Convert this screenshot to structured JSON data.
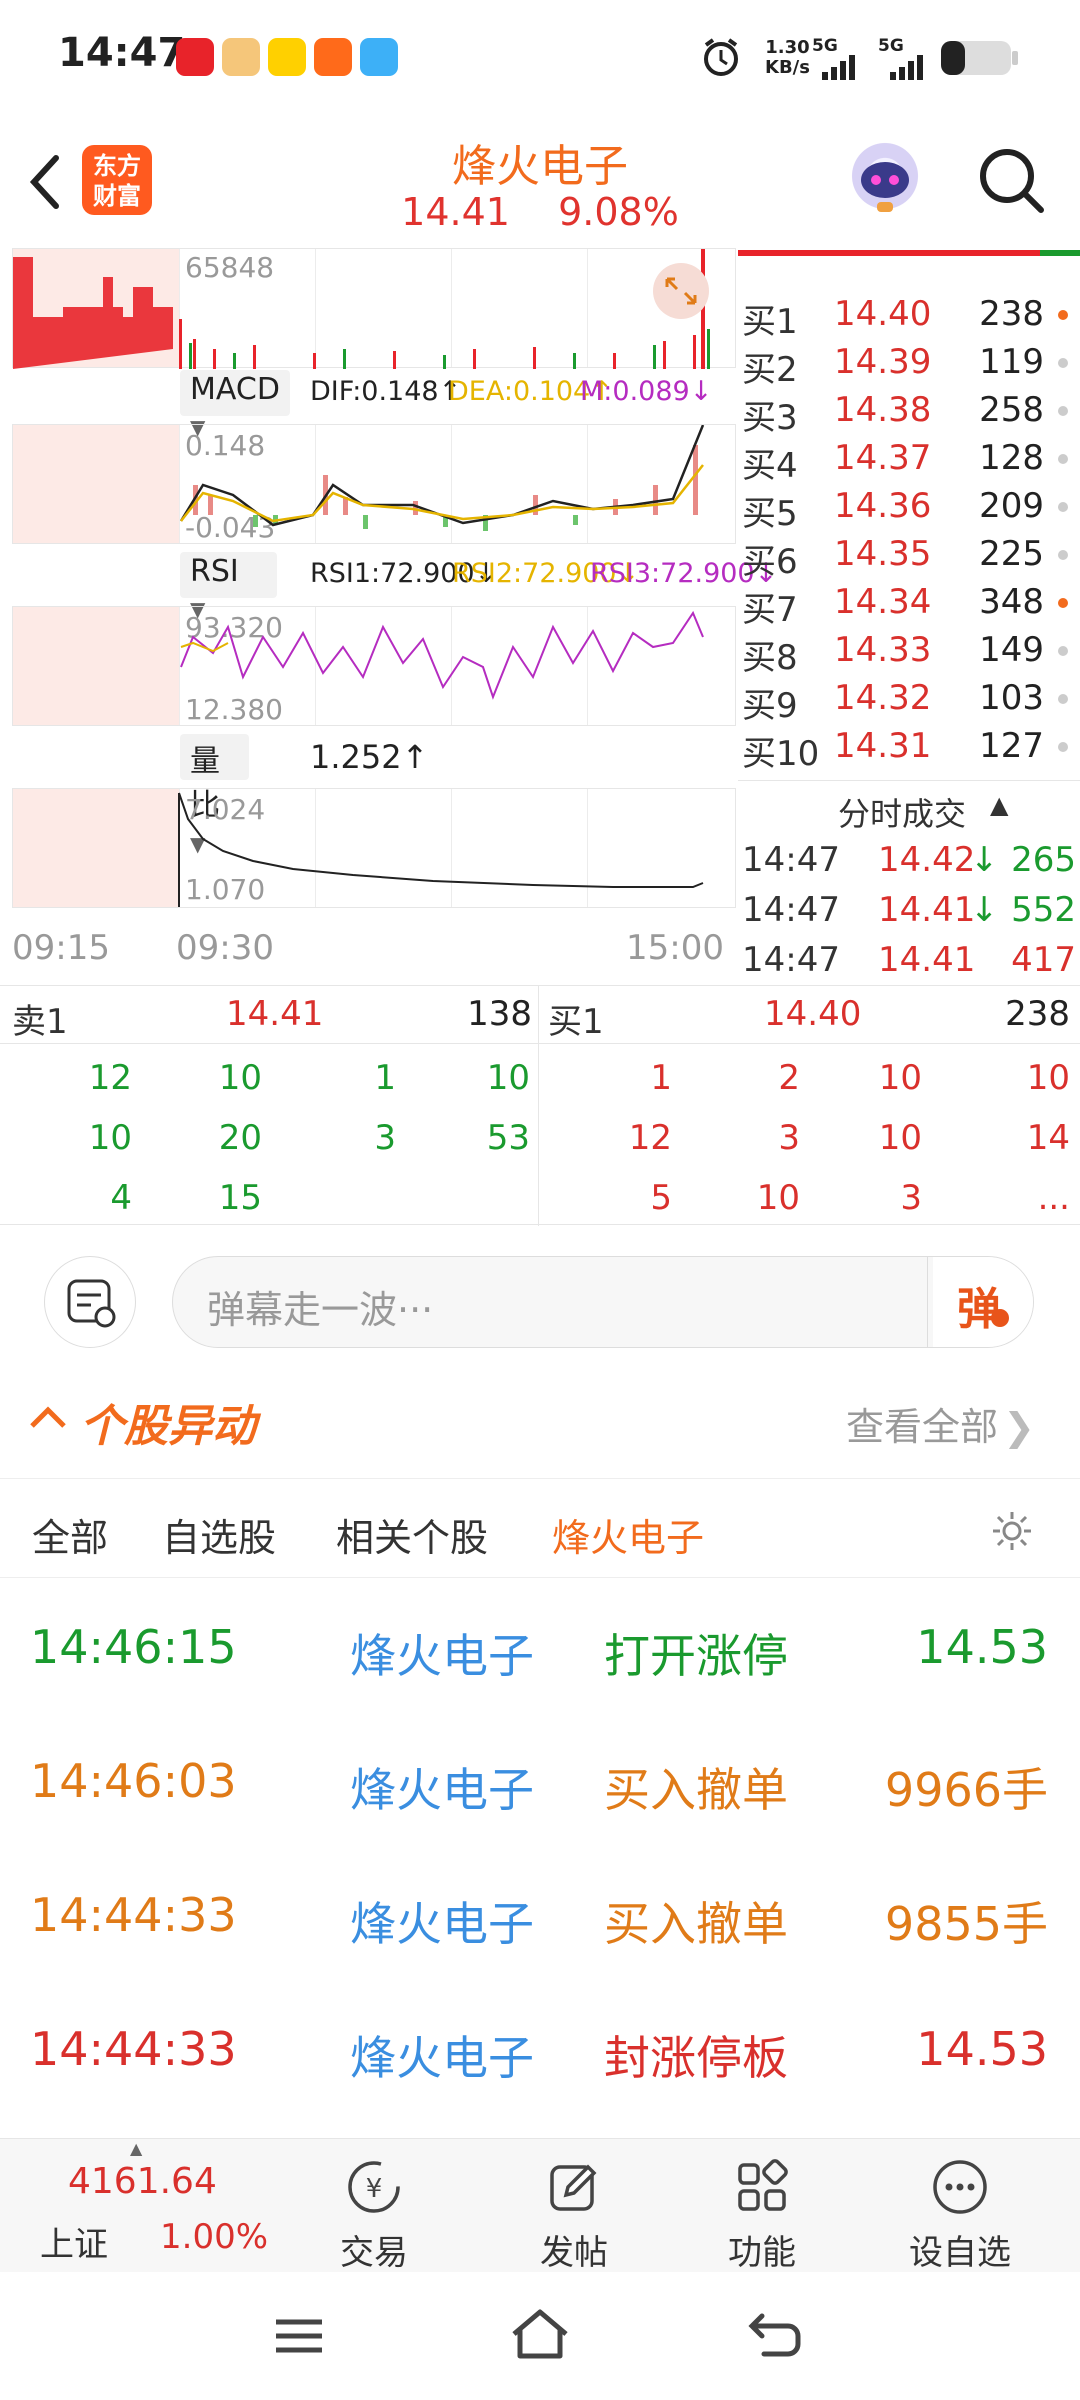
{
  "status_bar": {
    "time": "14:47",
    "net_speed_value": "1.30",
    "net_speed_unit": "KB/s",
    "sim1": "5G",
    "sim2": "5G",
    "app_icons": [
      "app-icon-1",
      "app-icon-2",
      "meituan-icon",
      "app-icon-4",
      "app-icon-5"
    ]
  },
  "header": {
    "logo_line1": "东方",
    "logo_line2": "财富",
    "stock_name": "烽火电子",
    "price": "14.41",
    "change_pct": "9.08%"
  },
  "chart": {
    "volume_label": "65848",
    "macd": {
      "selector": "MACD",
      "dif": "DIF:0.148↑",
      "dea": "DEA:0.104↑",
      "m": "M:0.089↓",
      "top": "0.148",
      "bottom": "-0.043"
    },
    "rsi": {
      "selector": "RSI",
      "rsi1": "RSI1:72.900↓",
      "rsi2": "RSI2:72.900↓",
      "rsi3": "RSI3:72.900↓",
      "top": "93.320",
      "bottom": "12.380"
    },
    "volratio": {
      "selector": "量比",
      "value": "1.252↑",
      "top": "7.024",
      "bottom": "1.070"
    },
    "time_axis": [
      "09:15",
      "09:30",
      "15:00"
    ]
  },
  "order_book": {
    "bids": [
      {
        "label": "买1",
        "price": "14.40",
        "vol": "238",
        "dot": "#f26b1d"
      },
      {
        "label": "买2",
        "price": "14.39",
        "vol": "119",
        "dot": "#cccccc"
      },
      {
        "label": "买3",
        "price": "14.38",
        "vol": "258",
        "dot": "#cccccc"
      },
      {
        "label": "买4",
        "price": "14.37",
        "vol": "128",
        "dot": "#cccccc"
      },
      {
        "label": "买5",
        "price": "14.36",
        "vol": "209",
        "dot": "#cccccc"
      },
      {
        "label": "买6",
        "price": "14.35",
        "vol": "225",
        "dot": "#cccccc"
      },
      {
        "label": "买7",
        "price": "14.34",
        "vol": "348",
        "dot": "#f26b1d"
      },
      {
        "label": "买8",
        "price": "14.33",
        "vol": "149",
        "dot": "#cccccc"
      },
      {
        "label": "买9",
        "price": "14.32",
        "vol": "103",
        "dot": "#cccccc"
      },
      {
        "label": "买10",
        "price": "14.31",
        "vol": "127",
        "dot": "#cccccc"
      }
    ],
    "ticks_title": "分时成交",
    "ticks": [
      {
        "time": "14:47",
        "price": "14.42",
        "arrow": "↓",
        "vol": "265",
        "color": "#1a9a2e"
      },
      {
        "time": "14:47",
        "price": "14.41",
        "arrow": "↓",
        "vol": "552",
        "color": "#1a9a2e"
      },
      {
        "time": "14:47",
        "price": "14.41",
        "arrow": "",
        "vol": "417",
        "color": "#d9302c"
      }
    ]
  },
  "queue": {
    "sell_label": "卖1",
    "sell_price": "14.41",
    "sell_total": "138",
    "buy_label": "买1",
    "buy_price": "14.40",
    "buy_total": "238",
    "sell_rows": [
      [
        "12",
        "10",
        "1",
        "10"
      ],
      [
        "10",
        "20",
        "3",
        "53"
      ],
      [
        "4",
        "15",
        "",
        ""
      ]
    ],
    "buy_rows": [
      [
        "1",
        "2",
        "10",
        "10"
      ],
      [
        "12",
        "3",
        "10",
        "14"
      ],
      [
        "5",
        "10",
        "3",
        "..."
      ]
    ]
  },
  "danmu": {
    "placeholder": "弹幕走一波···",
    "send_label": "弹"
  },
  "movement": {
    "title": "个股异动",
    "view_all": "查看全部",
    "tabs": [
      "全部",
      "自选股",
      "相关个股",
      "烽火电子"
    ],
    "events": [
      {
        "time": "14:46:15",
        "name": "烽火电子",
        "type": "打开涨停",
        "value": "14.53",
        "color": "#1a9a2e"
      },
      {
        "time": "14:46:03",
        "name": "烽火电子",
        "type": "买入撤单",
        "value": "9966手",
        "color": "#e07b18"
      },
      {
        "time": "14:44:33",
        "name": "烽火电子",
        "type": "买入撤单",
        "value": "9855手",
        "color": "#e07b18"
      },
      {
        "time": "14:44:33",
        "name": "烽火电子",
        "type": "封涨停板",
        "value": "14.53",
        "color": "#d9302c"
      }
    ]
  },
  "bottom_nav": {
    "index_value": "4161.64",
    "index_name": "上证",
    "index_change": "1.00%",
    "items": [
      "交易",
      "发帖",
      "功能",
      "设自选"
    ]
  }
}
